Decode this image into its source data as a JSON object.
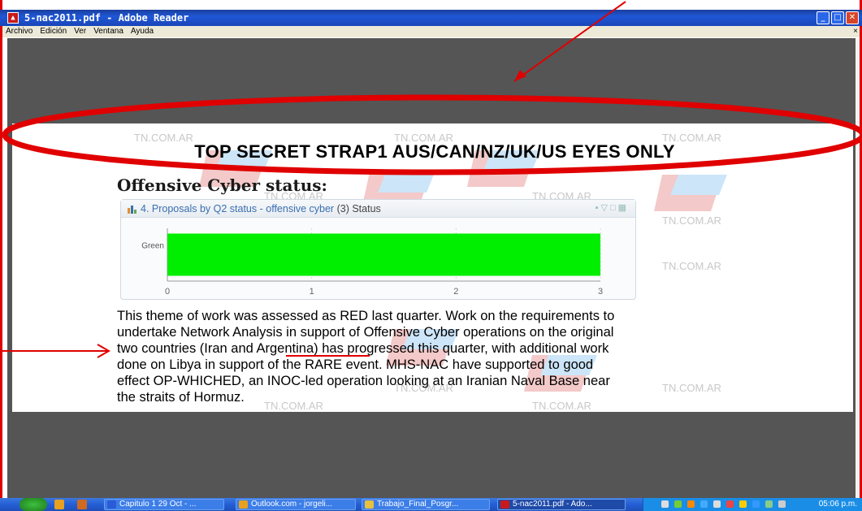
{
  "window": {
    "title": "5-nac2011.pdf - Adobe Reader",
    "controls": [
      "_",
      "□",
      "✕"
    ]
  },
  "menu": [
    "Archivo",
    "Edición",
    "Ver",
    "Ventana",
    "Ayuda"
  ],
  "document": {
    "banner": "TOP SECRET STRAP1 AUS/CAN/NZ/UK/US EYES ONLY",
    "section_title": "Offensive Cyber status:",
    "watermark": "TN.COM.AR",
    "panel": {
      "title_prefix": "4. Proposals by Q2 status - ",
      "title_link": "offensive cyber",
      "title_suffix": " (3) Status"
    },
    "body_lines": [
      "This theme of work was assessed as RED last quarter. Work on the requirements to",
      "undertake Network Analysis in support of Offensive Cyber operations on the original",
      "two countries (Iran and Argentina) has progressed this quarter, with additional work",
      "done on Libya in support of the RARE event. MHS-NAC have supported to good",
      "effect OP-WHICHED, an INOC-led operation looking at an Iranian Naval Base near",
      "the straits of Hormuz."
    ]
  },
  "chart_data": {
    "type": "bar",
    "orientation": "horizontal",
    "title": "4. Proposals by Q2 status - offensive cyber (3) Status",
    "categories": [
      "Green"
    ],
    "values": [
      3
    ],
    "xlim": [
      0,
      3
    ],
    "xticks": [
      0,
      1,
      2,
      3
    ],
    "bar_color": "#00ee00",
    "grid": true
  },
  "taskbar": {
    "tasks": [
      {
        "label": "Capitulo 1 29 Oct - ...",
        "icon_color": "#2a5bd8"
      },
      {
        "label": "Outlook.com - jorgeli...",
        "icon_color": "#e8a020"
      },
      {
        "label": "Trabajo_Final_Posgr...",
        "icon_color": "#e8c040"
      },
      {
        "label": "5-nac2011.pdf - Ado...",
        "icon_color": "#c81a1a"
      }
    ],
    "clock": "05:06 p.m."
  },
  "colors": {
    "annotation_red": "#e00000",
    "title_blue": "#1f57d6",
    "doc_background": "#555555"
  }
}
